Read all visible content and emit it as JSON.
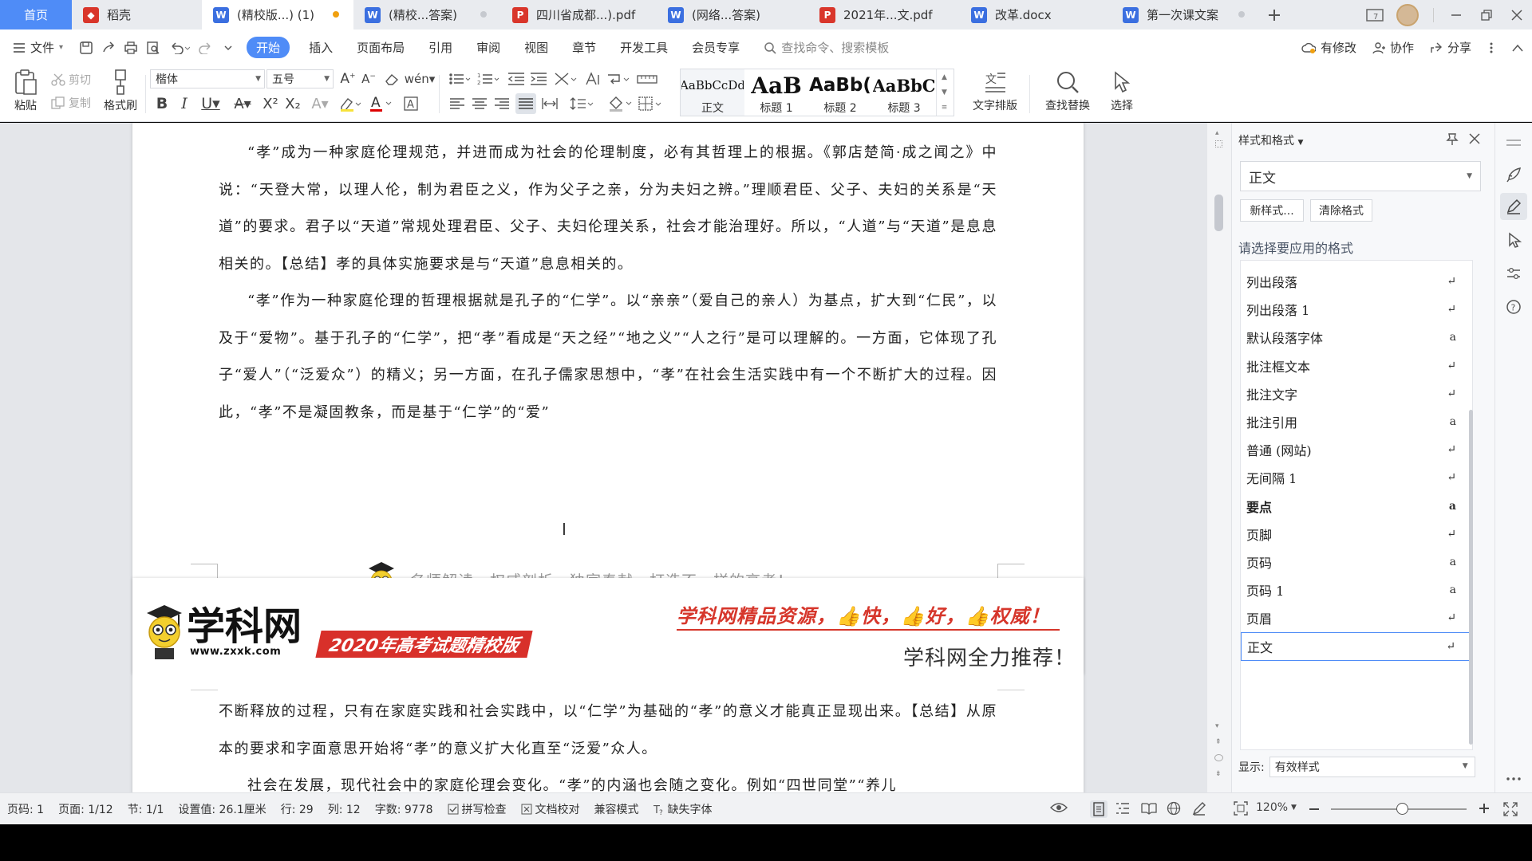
{
  "tabs": [
    {
      "label": "首页",
      "kind": "home"
    },
    {
      "label": "稻壳",
      "icon": "daoke-icon"
    },
    {
      "label": "(精校版...) (1)",
      "icon": "word-icon",
      "active": true,
      "modified": true
    },
    {
      "label": "(精校...答案)",
      "icon": "word-icon",
      "dot": true
    },
    {
      "label": "四川省成都...).pdf",
      "icon": "pdf-icon"
    },
    {
      "label": "(网络...答案)",
      "icon": "word-icon"
    },
    {
      "label": "2021年...文.pdf",
      "icon": "pdf-icon"
    },
    {
      "label": "改革.docx",
      "icon": "word-icon"
    },
    {
      "label": "第一次课文案",
      "icon": "word-icon",
      "dot": true
    }
  ],
  "menu": {
    "file": "文件",
    "items": [
      "开始",
      "插入",
      "页面布局",
      "引用",
      "审阅",
      "视图",
      "章节",
      "开发工具",
      "会员专享"
    ],
    "search_placeholder": "查找命令、搜索模板",
    "modified": "有修改",
    "collab": "协作",
    "share": "分享"
  },
  "ribbon": {
    "paste": "粘贴",
    "cut": "剪切",
    "copy": "复制",
    "format_painter": "格式刷",
    "font_name": "楷体",
    "font_size": "五号",
    "gallery": [
      {
        "preview": "AaBbCcDd",
        "name": "正文"
      },
      {
        "preview": "AaB",
        "name": "标题 1"
      },
      {
        "preview": "AaBb(",
        "name": "标题 2"
      },
      {
        "preview": "AaBbC",
        "name": "标题 3"
      }
    ],
    "text_layout": "文字排版",
    "find_replace": "查找替换",
    "select": "选择"
  },
  "document": {
    "page1_paragraphs": [
      "“孝”成为一种家庭伦理规范，并进而成为社会的伦理制度，必有其哲理上的根据。《郭店楚简·成之闻之》中说：“天登大常，以理人伦，制为君臣之义，作为父子之亲，分为夫妇之辨。”理顺君臣、父子、夫妇的关系是“天道”的要求。君子以“天道”常规处理君臣、父子、夫妇伦理关系，社会才能治理好。所以，“人道”与“天道”是息息相关的。【总结】孝的具体实施要求是与“天道”息息相关的。",
      "“孝”作为一种家庭伦理的哲理根据就是孔子的“仁学”。以“亲亲”（爱自己的亲人）为基点，扩大到“仁民”，以及于“爱物”。基于孔子的“仁学”，把“孝”看成是“天之经”“地之义”“人之行”是可以理解的。一方面，它体现了孔子“爱人”（“泛爱众”）的精义；另一方面，在孔子儒家思想中，“孝”在社会生活实践中有一个不断扩大的过程。因此，“孝”不是凝固教条，而是基于“仁学”的“爱”"
    ],
    "page1_footer": "名师解读，权威剖析，独家奉献，打造不一样的高考！",
    "page2_header": {
      "logo": "学科网",
      "logo_url": "www.zxxk.com",
      "banner": "2020年高考试题精校版",
      "slogan": "学科网精品资源，👍快，👍好，👍权威！",
      "recommend": "学科网全力推荐！"
    },
    "page2_paragraphs": [
      "不断释放的过程，只有在家庭实践和社会实践中，以“仁学”为基础的“孝”的意义才能真正显现出来。【总结】从原本的要求和字面意思开始将“孝”的意义扩大化直至“泛爱”众人。",
      "社会在发展，现代社会中的家庭伦理会变化。“孝”的内涵也会随之变化。例如“四世同堂”“养儿"
    ]
  },
  "styles_panel": {
    "title": "样式和格式",
    "current": "正文",
    "new_style": "新样式...",
    "clear_format": "清除格式",
    "apply_label": "请选择要应用的格式",
    "items": [
      {
        "name": "列出段落",
        "mark": "↵"
      },
      {
        "name": "列出段落 1",
        "mark": "↵"
      },
      {
        "name": "默认段落字体",
        "mark": "a"
      },
      {
        "name": "批注框文本",
        "mark": "↵"
      },
      {
        "name": "批注文字",
        "mark": "↵"
      },
      {
        "name": "批注引用",
        "mark": "a"
      },
      {
        "name": "普通 (网站)",
        "mark": "↵"
      },
      {
        "name": "无间隔 1",
        "mark": "↵"
      },
      {
        "name": "要点",
        "mark": "a",
        "bold": true
      },
      {
        "name": "页脚",
        "mark": "↵"
      },
      {
        "name": "页码",
        "mark": "a"
      },
      {
        "name": "页码 1",
        "mark": "a"
      },
      {
        "name": "页眉",
        "mark": "↵"
      },
      {
        "name": "正文",
        "mark": "↵",
        "current": true
      }
    ],
    "show_label": "显示:",
    "show_value": "有效样式"
  },
  "status": {
    "page_code": "页码: 1",
    "page": "页面: 1/12",
    "section": "节: 1/1",
    "setting": "设置值: 26.1厘米",
    "row": "行: 29",
    "col": "列: 12",
    "words": "字数: 9778",
    "spell": "拼写检查",
    "proof": "文档校对",
    "compat": "兼容模式",
    "missing_font": "缺失字体",
    "zoom": "120%"
  },
  "colors": {
    "accent": "#4f8cf7",
    "banner": "#d8302a",
    "doc_bg": "#e4e6ea"
  }
}
